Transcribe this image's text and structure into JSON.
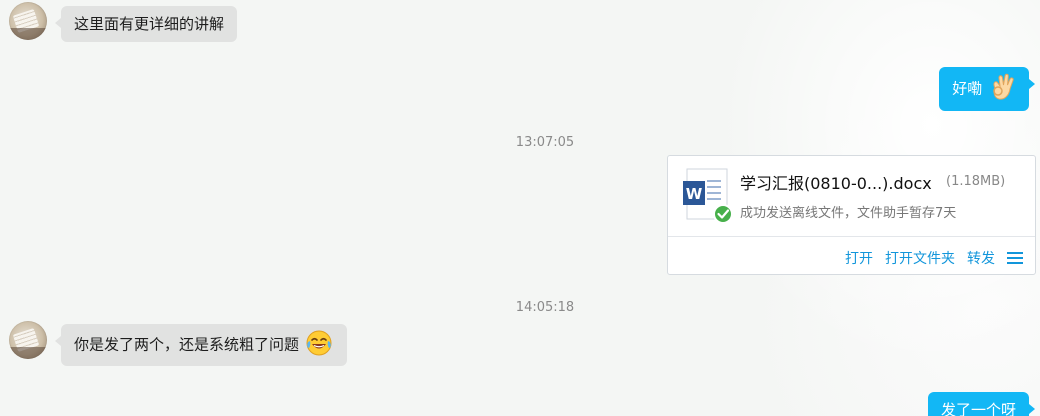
{
  "messages": [
    {
      "text": "这里面有更详细的讲解"
    },
    {
      "text": "好嘞",
      "emoji": "ok-hand-emoji"
    },
    {
      "text": "你是发了两个，还是系统粗了问题",
      "emoji": "tears-of-joy-emoji"
    },
    {
      "text": "发了一个呀"
    }
  ],
  "timestamps": [
    "13:07:05",
    "14:05:18"
  ],
  "file": {
    "name": "学习汇报(0810-0...).docx",
    "size": "(1.18MB)",
    "status": "成功发送离线文件，文件助手暂存7天",
    "icon": "word-doc-icon",
    "actions": [
      "打开",
      "打开文件夹",
      "转发"
    ],
    "menu_icon": "hamburger-menu-icon"
  },
  "colors": {
    "outgoing_bubble": "#12b7f5",
    "incoming_bubble": "#e1e2e1",
    "action_link": "#1296db",
    "word_blue": "#2b5797",
    "success_green": "#47b04b"
  }
}
